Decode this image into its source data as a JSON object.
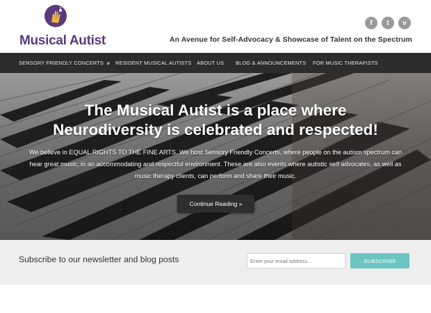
{
  "brand": {
    "name": "Musical Autist",
    "accent": "#5b3a7e"
  },
  "header": {
    "tagline": "An Avenue for Self-Advocacy & Showcase of Talent on the Spectrum"
  },
  "social": [
    {
      "icon": "facebook-icon",
      "glyph": "f"
    },
    {
      "icon": "twitter-icon",
      "glyph": "t"
    },
    {
      "icon": "vimeo-icon",
      "glyph": "v"
    }
  ],
  "nav": {
    "items": [
      {
        "label": "SENSORY FRIENDLY CONCERTS",
        "has_submenu": true
      },
      {
        "label": "RESIDENT MUSICAL AUTISTS"
      },
      {
        "label": "ABOUT US"
      },
      {
        "label": "BLOG & ANNOUNCEMENTS"
      },
      {
        "label": "FOR MUSIC THERAPISTS"
      }
    ],
    "submenu_glyph": "⊗"
  },
  "hero": {
    "title_line1": "The Musical Autist is a place where",
    "title_line2": "Neurodiversity is celebrated and respected!",
    "body": "We believe in EQUAL RIGHTS TO THE FINE ARTS. We host Sensory Friendly Concerts, where people on the autism spectrum can hear great music, in an accommodating and respectful environment. These are also events where autistic self advocates, as well as music therapy clients, can perform and share their music.",
    "cta_label": "Continue Reading »"
  },
  "newsletter": {
    "label": "Subscribe to our newsletter and blog posts",
    "email_placeholder": "Enter your email address...",
    "button_label": "SUBSCRIBE",
    "button_color": "#6cc4c2"
  }
}
